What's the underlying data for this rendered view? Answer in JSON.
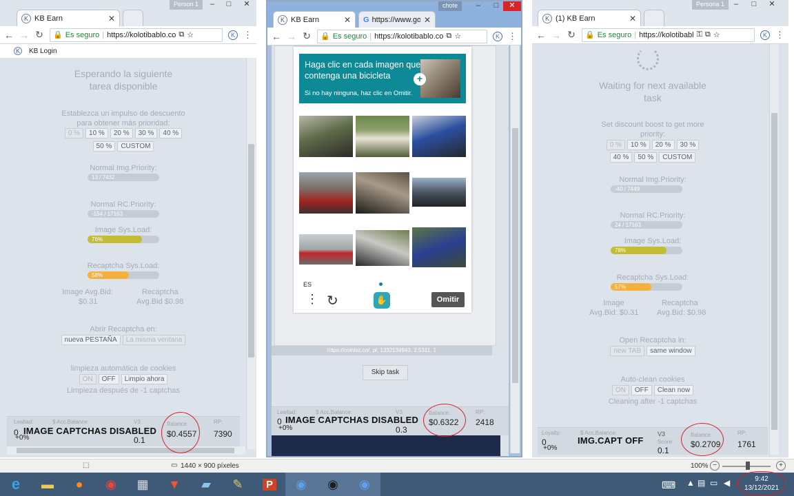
{
  "windows": {
    "left": {
      "profile": "Person 1",
      "tab_title": "KB Earn",
      "secure_label": "Es seguro",
      "url": "https://kolotibablo.co",
      "bookmark": "KB Login",
      "waiting_title": "Esperando la siguiente tarea disponible",
      "boost_label": "Establezca un impulso de descuento para obtener más prioridad:",
      "boost_options": [
        "0 %",
        "10 %",
        "20 %",
        "30 %",
        "40 %",
        "50 %",
        "CUSTOM"
      ],
      "normal_img_label": "Normal Img.Priority:",
      "normal_img_value": "13 / 7432",
      "normal_rc_label": "Normal RC.Priority:",
      "normal_rc_value": "-154 / 17163",
      "image_sys_label": "Image Sys.Load:",
      "image_sys_value": "76%",
      "image_sys_pct": 76,
      "recaptcha_sys_label": "Recaptcha Sys.Load:",
      "recaptcha_sys_value": "58%",
      "recaptcha_sys_pct": 58,
      "image_bid_label": "Image Avg.Bid:",
      "image_bid_value": "$0.31",
      "recaptcha_bid_label": "Recaptcha",
      "recaptcha_bid_value": "Avg.Bid $0.98",
      "open_in_label": "Abrir Recaptcha en:",
      "open_new_tab": "nueva PESTAÑA",
      "open_same_window": "La misma ventana",
      "cookies_label": "limpieza automática de cookies",
      "cookies_on": "ON",
      "cookies_off": "OFF",
      "cookies_clean_now": "Limpio ahora",
      "cookies_note": "Limpieza después de -1 captchas",
      "footer": {
        "loyalty_label": "Lealtad:",
        "acc_balance_label": "$ Acc.Balance:",
        "loyalty_value": "0",
        "loyalty_pct": "+0%",
        "v3_label": "V3",
        "v3_value": "0.1",
        "balance_label": "Balance:",
        "balance_value": "$0.4557",
        "rp_label": "RP:",
        "rp_value": "7390",
        "overlay": "IMAGE CAPTCHAS DISABLED"
      }
    },
    "middle": {
      "profile": "chote",
      "tab_title": "KB Earn",
      "tab2_title": "https://www.go",
      "secure_label": "Es seguro",
      "url": "https://kolotibablo.co",
      "captcha": {
        "instruction": "Haga clic en cada imagen que contenga una bicicleta",
        "hint": "Si no hay ninguna, haz clic en Omitir.",
        "lang": "ES",
        "skip_button": "Omitir"
      },
      "source_url": "https://coinlist.co/, pl, 1332134943, 2.5311, 1",
      "skip_task": "Skip task",
      "footer": {
        "loyalty_label": "Lealtad:",
        "acc_balance_label": "$ Acc.Balance:",
        "loyalty_value": "0",
        "loyalty_pct": "+0%",
        "v3_label": "V3",
        "v3_value": "0.3",
        "balance_label": "Balance:",
        "balance_value": "$0.6322",
        "rp_label": "RP:",
        "rp_value": "2418",
        "overlay": "IMAGE CAPTCHAS DISABLED"
      }
    },
    "right": {
      "profile": "Persona 1",
      "tab_title": "(1) KB Earn",
      "secure_label": "Es seguro",
      "url": "https://kolotibabl",
      "waiting_title": "Waiting for next available task",
      "boost_label": "Set discount boost to get more priority:",
      "boost_options": [
        "0 %",
        "10 %",
        "20 %",
        "30 %",
        "40 %",
        "50 %",
        "CUSTOM"
      ],
      "normal_img_label": "Normal Img.Priority:",
      "normal_img_value": "-40 / 7449",
      "normal_rc_label": "Normal RC.Priority:",
      "normal_rc_value": "24 / 17163",
      "image_sys_label": "Image Sys.Load:",
      "image_sys_value": "78%",
      "image_sys_pct": 78,
      "recaptcha_sys_label": "Recaptcha Sys.Load:",
      "recaptcha_sys_value": "57%",
      "recaptcha_sys_pct": 57,
      "image_bid_label": "Image",
      "image_bid_value": "Avg.Bid: $0.31",
      "recaptcha_bid_label": "Recaptcha",
      "recaptcha_bid_value": "Avg.Bid: $0.98",
      "open_in_label": "Open Recaptcha in:",
      "open_new_tab": "new TAB",
      "open_same_window": "same window",
      "cookies_label": "Auto-clean cookies",
      "cookies_on": "ON",
      "cookies_off": "OFF",
      "cookies_clean_now": "Clean now",
      "cookies_note": "Cleaning after -1 captchas",
      "footer": {
        "loyalty_label": "Loyalty:",
        "acc_balance_label": "$ Acc.Balance:",
        "loyalty_value": "0",
        "loyalty_pct": "+0%",
        "v3_label": "V3",
        "score_label": "Score:",
        "v3_value": "0.1",
        "balance_label": "Balance:",
        "balance_value": "$0.2709",
        "rp_label": "RP:",
        "rp_value": "1761",
        "overlay": "IMG.CAPT OFF"
      }
    }
  },
  "statusbar": {
    "dimensions": "1440 × 900 píxeles",
    "zoom": "100%"
  },
  "taskbar": {
    "time": "9:42",
    "date": "13/12/2021"
  },
  "colors": {
    "image_load": "#c2bd34",
    "recaptcha_load": "#f5b13c",
    "captcha_header": "#0e8a96",
    "annotation": "#d8232a"
  }
}
